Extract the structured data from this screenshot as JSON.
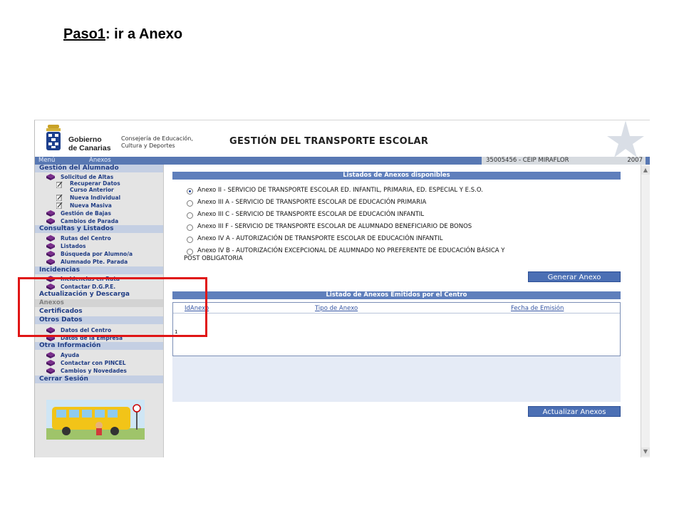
{
  "slide": {
    "title_underlined": "Paso1",
    "title_rest": ": ir a Anexo"
  },
  "header": {
    "gov_line1": "Gobierno",
    "gov_line2": "de Canarias",
    "cons_line1": "Consejería de Educación,",
    "cons_line2": "Cultura y Deportes",
    "app_title": "GESTIÓN DEL TRANSPORTE ESCOLAR"
  },
  "menubar": {
    "menu": "Menú",
    "section": "Anexos",
    "centro": "35005456 - CEIP MIRAFLOR",
    "year": "2007"
  },
  "sidebar": {
    "gestion": "Gestión del Alumnado",
    "solicitud": "Solicitud de Altas",
    "recuperar1": "Recuperar Datos",
    "recuperar2": "Curso Anterior",
    "nueva_individual": "Nueva Individual",
    "nueva_masiva": "Nueva Masiva",
    "bajas": "Gestión de Bajas",
    "cambios_parada": "Cambios de Parada",
    "consultas": "Consultas y Listados",
    "rutas": "Rutas del Centro",
    "listados": "Listados",
    "busqueda": "Búsqueda por Alumno/a",
    "pte_parada": "Alumnado Pte. Parada",
    "incidencias": "Incidencias",
    "incidencias_item": "Incidencias en Ruta",
    "contactar_dgpe": "Contactar D.G.P.E.",
    "actualizacion": "Actualización y Descarga",
    "anexos": "Anexos",
    "certificados": "Certificados",
    "otros_datos": "Otros Datos",
    "datos_centro": "Datos del Centro",
    "datos_empresa": "Datos de la Empresa",
    "otra_info": "Otra Información",
    "ayuda": "Ayuda",
    "contactar_pincel": "Contactar con PINCEL",
    "cambios_novedades": "Cambios y Novedades",
    "cerrar": "Cerrar Sesión"
  },
  "main": {
    "listados_header": "Listados de Anexos disponibles",
    "options": [
      "Anexo II - SERVICIO DE TRANSPORTE ESCOLAR ED. INFANTIL, PRIMARIA, ED. ESPECIAL Y E.S.O.",
      "Anexo III A - SERVICIO DE TRANSPORTE ESCOLAR DE EDUCACIÓN PRIMARIA",
      "Anexo III C - SERVICIO DE TRANSPORTE ESCOLAR DE EDUCACIÓN INFANTIL",
      "Anexo III F - SERVICIO DE TRANSPORTE ESCOLAR DE ALUMNADO BENEFICIARIO DE BONOS",
      "Anexo IV A - AUTORIZACIÓN DE TRANSPORTE ESCOLAR DE EDUCACIÓN INFANTIL",
      "Anexo IV B - AUTORIZACIÓN EXCEPCIONAL DE ALUMNADO NO PREFERENTE DE EDUCACIÓN BÁSICA Y",
      "POST OBLIGATORIA"
    ],
    "generar_button": "Generar Anexo",
    "emitidos_header": "Listado de Anexos Emitidos por el Centro",
    "col_id": "IdAnexo",
    "col_tipo": "Tipo de Anexo",
    "col_fecha": "Fecha de Emisión",
    "cell_value": "1",
    "actualizar_button": "Actualizar Anexos"
  },
  "colors": {
    "accent_blue": "#5f7fbc",
    "highlight_red": "#e01515",
    "menu_blue": "#5878b3"
  }
}
